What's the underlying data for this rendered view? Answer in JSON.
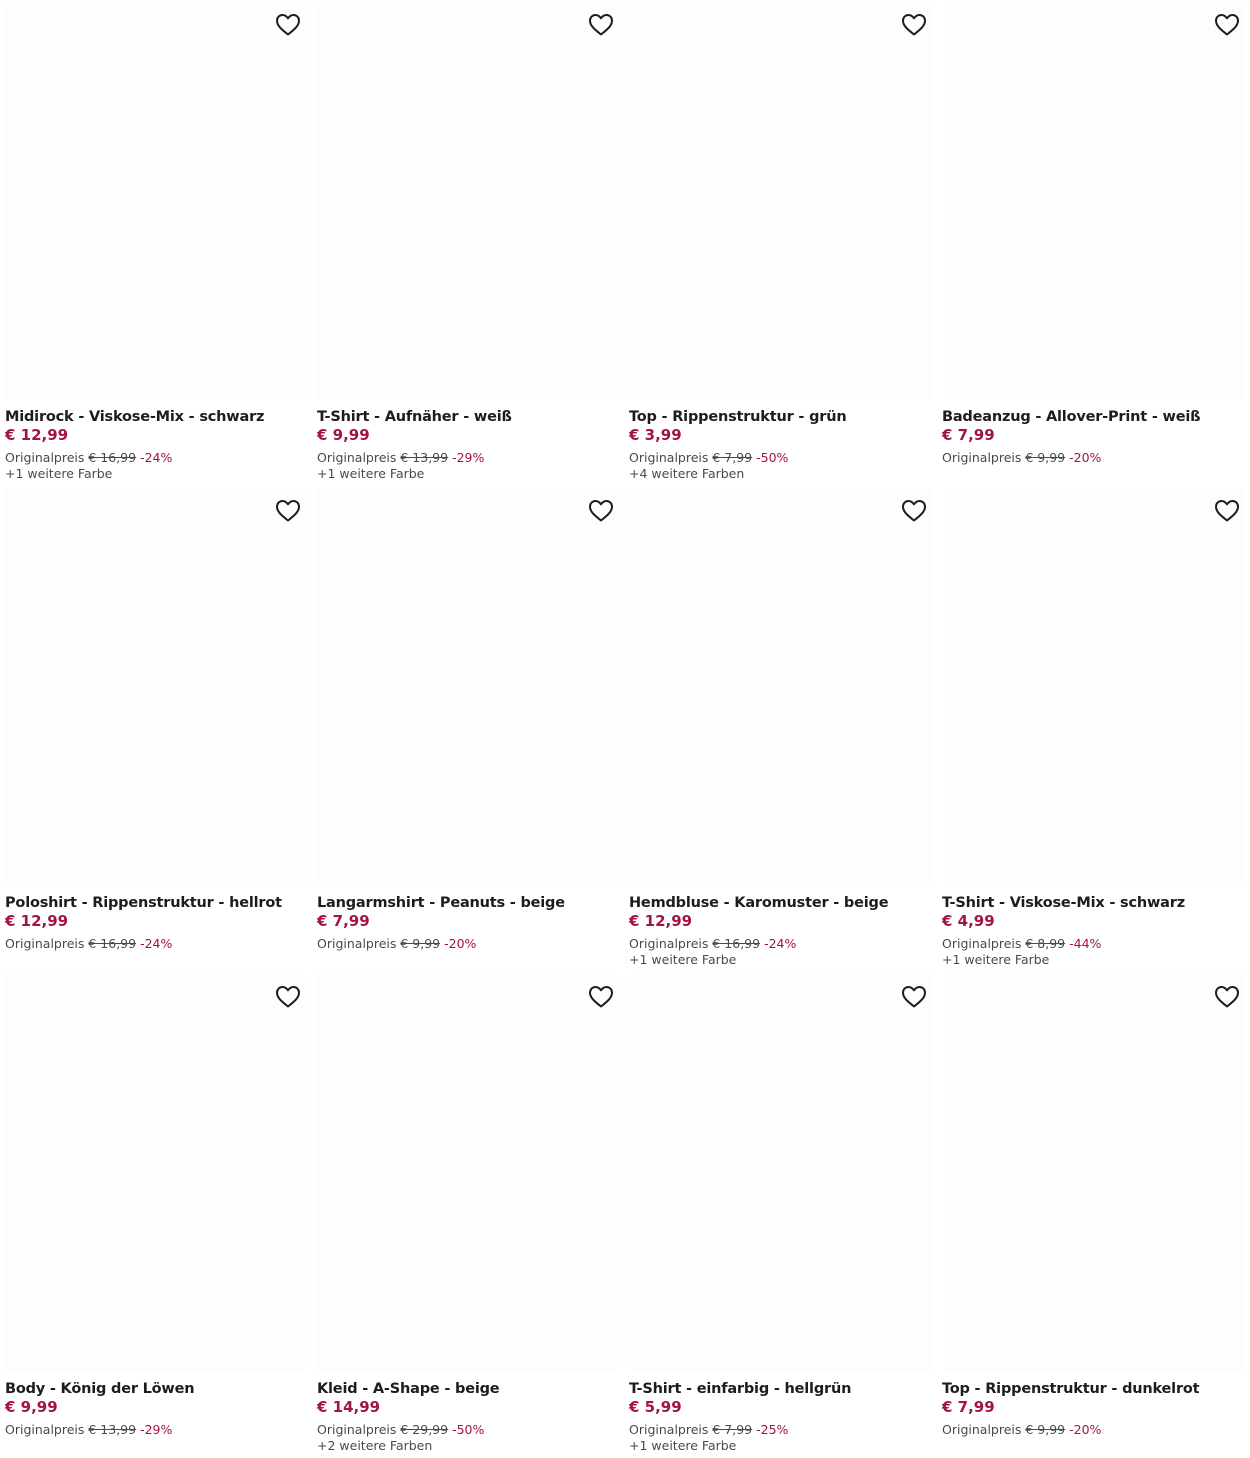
{
  "labels": {
    "original_price_label": "Originalpreis"
  },
  "products": [
    {
      "title": "Midirock - Viskose-Mix - schwarz",
      "price": "€ 12,99",
      "old_price": "€ 16,99",
      "discount": "-24%",
      "colors": "+1 weitere Farbe"
    },
    {
      "title": "T-Shirt - Aufnäher - weiß",
      "price": "€ 9,99",
      "old_price": "€ 13,99",
      "discount": "-29%",
      "colors": "+1 weitere Farbe"
    },
    {
      "title": "Top - Rippenstruktur - grün",
      "price": "€ 3,99",
      "old_price": "€ 7,99",
      "discount": "-50%",
      "colors": "+4 weitere Farben"
    },
    {
      "title": "Badeanzug - Allover-Print - weiß",
      "price": "€ 7,99",
      "old_price": "€ 9,99",
      "discount": "-20%",
      "colors": ""
    },
    {
      "title": "Poloshirt - Rippenstruktur - hellrot",
      "price": "€ 12,99",
      "old_price": "€ 16,99",
      "discount": "-24%",
      "colors": ""
    },
    {
      "title": "Langarmshirt - Peanuts - beige",
      "price": "€ 7,99",
      "old_price": "€ 9,99",
      "discount": "-20%",
      "colors": ""
    },
    {
      "title": "Hemdbluse - Karomuster - beige",
      "price": "€ 12,99",
      "old_price": "€ 16,99",
      "discount": "-24%",
      "colors": "+1 weitere Farbe"
    },
    {
      "title": "T-Shirt - Viskose-Mix - schwarz",
      "price": "€ 4,99",
      "old_price": "€ 8,99",
      "discount": "-44%",
      "colors": "+1 weitere Farbe"
    },
    {
      "title": "Body - König der Löwen",
      "price": "€ 9,99",
      "old_price": "€ 13,99",
      "discount": "-29%",
      "colors": ""
    },
    {
      "title": "Kleid - A-Shape - beige",
      "price": "€ 14,99",
      "old_price": "€ 29,99",
      "discount": "-50%",
      "colors": "+2 weitere Farben"
    },
    {
      "title": "T-Shirt - einfarbig - hellgrün",
      "price": "€ 5,99",
      "old_price": "€ 7,99",
      "discount": "-25%",
      "colors": "+1 weitere Farbe"
    },
    {
      "title": "Top - Rippenstruktur - dunkelrot",
      "price": "€ 7,99",
      "old_price": "€ 9,99",
      "discount": "-20%",
      "colors": ""
    }
  ],
  "icons": {
    "favorite": "heart-outline-icon"
  },
  "colors": {
    "sale_price": "#a2153f",
    "text": "#1d1d1d",
    "muted": "#4a4a4a"
  }
}
